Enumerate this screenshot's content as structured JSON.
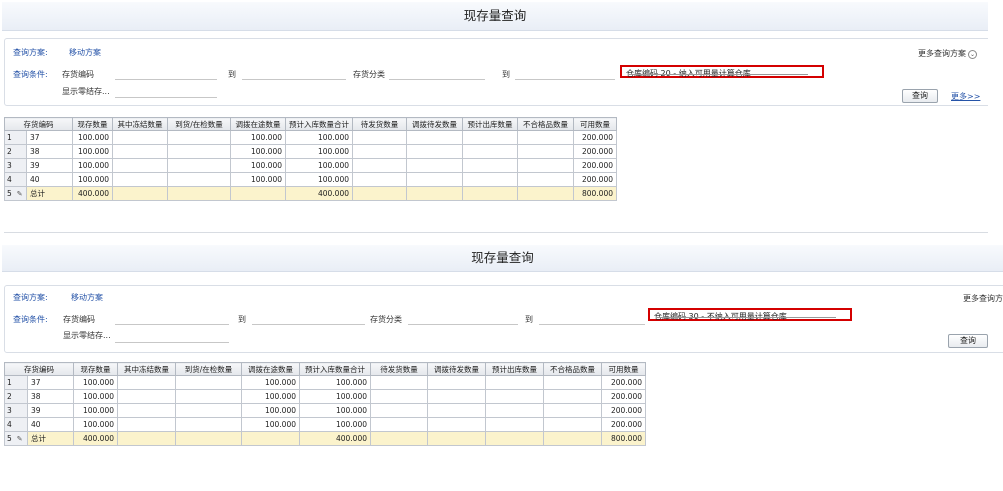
{
  "screens": [
    {
      "title": "现存量查询",
      "scheme_label": "查询方案:",
      "scheme_value": "移动方案",
      "more_schemes": "更多查询方案",
      "condition_label": "查询条件:",
      "inventory_code_label": "存货编码",
      "to_label_1": "到",
      "inventory_class_label": "存货分类",
      "to_label_2": "到",
      "warehouse_filter": "仓库编码   20 - 纳入可用量计算仓库",
      "show_zero_label": "显示零结存...",
      "query_button": "查询",
      "more_link": "更多>>"
    },
    {
      "title": "现存量查询",
      "scheme_label": "查询方案:",
      "scheme_value": "移动方案",
      "more_schemes": "更多查询方",
      "condition_label": "查询条件:",
      "inventory_code_label": "存货编码",
      "to_label_1": "到",
      "inventory_class_label": "存货分类",
      "to_label_2": "到",
      "warehouse_filter": "仓库编码   30 - 不纳入可用量计算仓库",
      "show_zero_label": "显示零结存...",
      "query_button": "查询",
      "more_link": ""
    }
  ],
  "table": {
    "headers": [
      "存货编码",
      "现存数量",
      "其中冻结数量",
      "到货/在检数量",
      "调拨在途数量",
      "预计入库数量合计",
      "待发货数量",
      "调拨待发数量",
      "预计出库数量",
      "不合格品数量",
      "可用数量"
    ],
    "rows": [
      {
        "no": "1",
        "cells": [
          "37",
          "100.000",
          "",
          "",
          "100.000",
          "100.000",
          "",
          "",
          "",
          "",
          "200.000"
        ]
      },
      {
        "no": "2",
        "cells": [
          "38",
          "100.000",
          "",
          "",
          "100.000",
          "100.000",
          "",
          "",
          "",
          "",
          "200.000"
        ]
      },
      {
        "no": "3",
        "cells": [
          "39",
          "100.000",
          "",
          "",
          "100.000",
          "100.000",
          "",
          "",
          "",
          "",
          "200.000"
        ]
      },
      {
        "no": "4",
        "cells": [
          "40",
          "100.000",
          "",
          "",
          "100.000",
          "100.000",
          "",
          "",
          "",
          "",
          "200.000"
        ]
      }
    ],
    "total": {
      "no": "5",
      "cells": [
        "总计",
        "400.000",
        "",
        "",
        "",
        "400.000",
        "",
        "",
        "",
        "",
        "800.000"
      ]
    }
  }
}
